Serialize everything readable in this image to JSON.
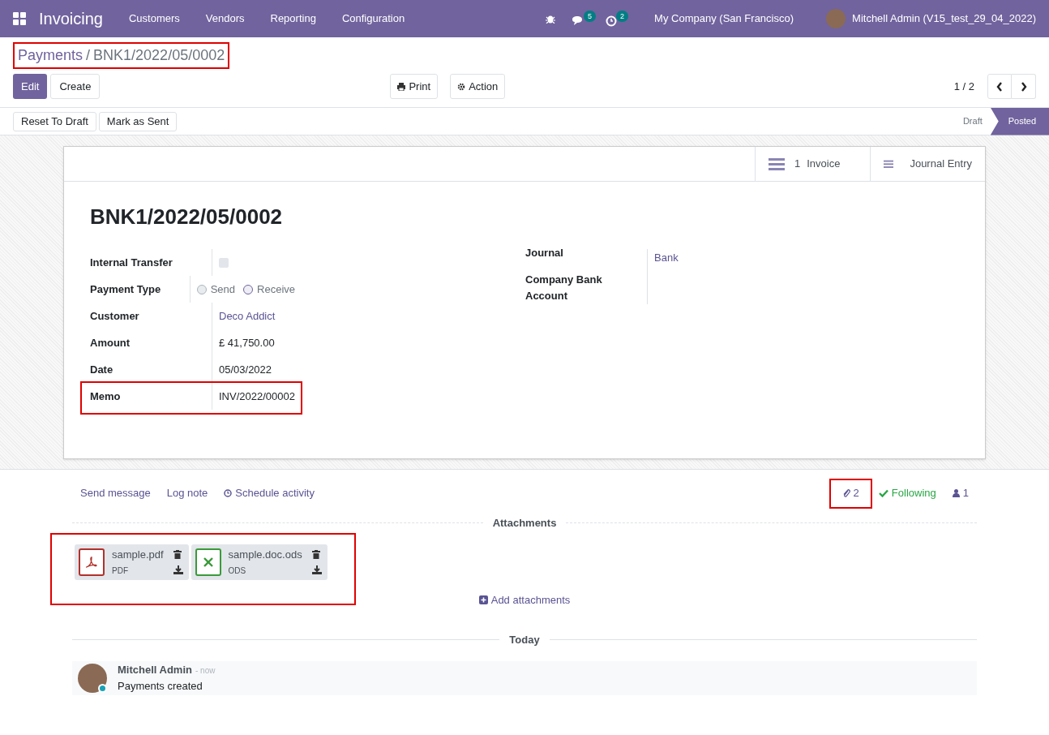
{
  "navbar": {
    "app": "Invoicing",
    "menus": [
      "Customers",
      "Vendors",
      "Reporting",
      "Configuration"
    ],
    "messages_count": "5",
    "activities_count": "2",
    "company": "My Company (San Francisco)",
    "user": "Mitchell Admin (V15_test_29_04_2022)"
  },
  "breadcrumb": {
    "parent": "Payments",
    "separator": "/",
    "current": "BNK1/2022/05/0002",
    "highlighted": true
  },
  "buttons": {
    "edit": "Edit",
    "create": "Create",
    "print": "Print",
    "action": "Action"
  },
  "pager": "1 / 2",
  "header_buttons": [
    "Reset To Draft",
    "Mark as Sent"
  ],
  "statuses": [
    {
      "label": "Draft",
      "selected": false
    },
    {
      "label": "Posted",
      "selected": true
    }
  ],
  "smart_buttons": [
    {
      "count": "1",
      "label": "Invoice"
    },
    {
      "label": "Journal Entry"
    }
  ],
  "title": "BNK1/2022/05/0002",
  "left_fields": [
    {
      "kind": "checkbox",
      "label": "Internal Transfer",
      "checked": false,
      "highlighted": false
    },
    {
      "kind": "radio",
      "label": "Payment Type",
      "options": [
        {
          "label": "Send",
          "selected": false
        },
        {
          "label": "Receive",
          "selected": true
        }
      ],
      "highlighted": false
    },
    {
      "kind": "link",
      "label": "Customer",
      "value": "Deco Addict",
      "highlighted": false
    },
    {
      "kind": "text",
      "label": "Amount",
      "value": "£ 41,750.00",
      "highlighted": false
    },
    {
      "kind": "text",
      "label": "Date",
      "value": "05/03/2022",
      "highlighted": false
    },
    {
      "kind": "text",
      "label": "Memo",
      "value": "INV/2022/00002",
      "highlighted": true
    }
  ],
  "right_fields": [
    {
      "kind": "link",
      "label": "Journal",
      "value": "Bank"
    },
    {
      "kind": "text",
      "label": "Company Bank Account"
    }
  ],
  "chatter": {
    "send_message": "Send message",
    "log_note": "Log note",
    "schedule_activity": "Schedule activity",
    "attachment_count": "2",
    "attachment_count_highlighted": true,
    "following": "Following",
    "followers": "1",
    "attachments_title": "Attachments",
    "attachments_highlighted": true,
    "attachments": [
      {
        "kind": "pdf",
        "name": "sample.pdf",
        "type": "PDF"
      },
      {
        "kind": "sheet",
        "name": "sample.doc.ods",
        "type": "ODS"
      }
    ],
    "add_attachments": "Add attachments",
    "day": "Today",
    "messages": [
      {
        "author": "Mitchell Admin",
        "time": "- now",
        "body": "Payments created"
      }
    ]
  }
}
